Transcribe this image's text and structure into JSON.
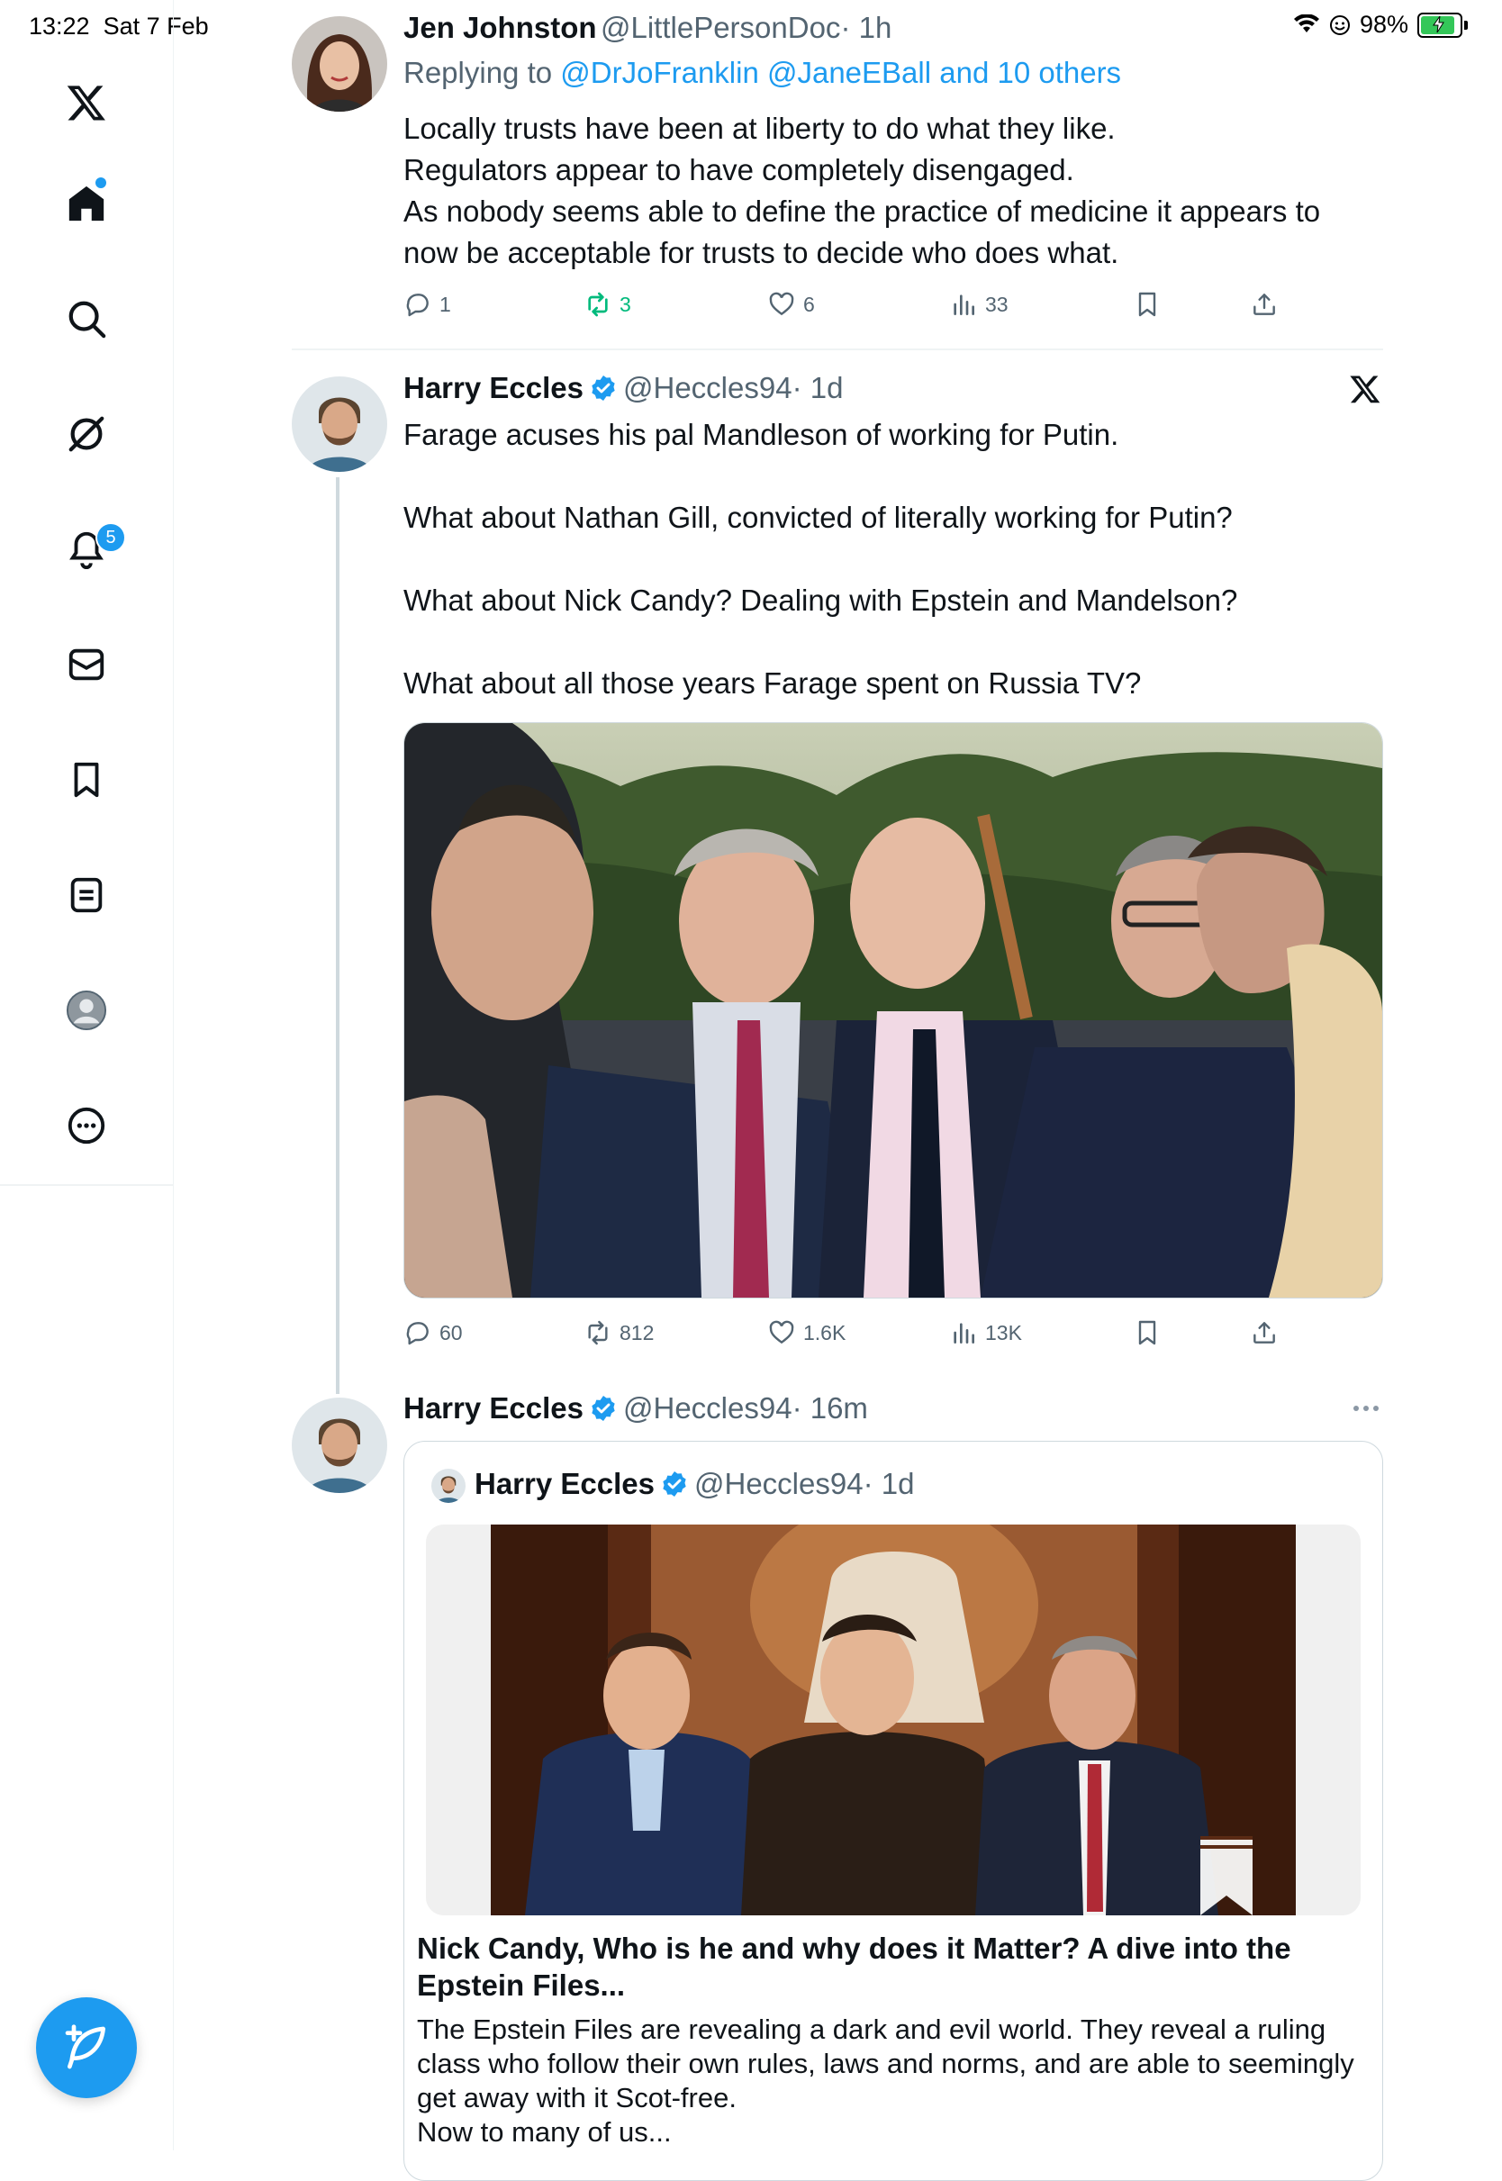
{
  "status_bar": {
    "time": "13:22",
    "date": "Sat 7 Feb",
    "battery": "98%",
    "battery_level": 0.98
  },
  "sidebar": {
    "items": [
      {
        "name": "x-logo-icon"
      },
      {
        "name": "home-icon"
      },
      {
        "name": "search-icon"
      },
      {
        "name": "grok-icon"
      },
      {
        "name": "notifications-icon",
        "badge": "5"
      },
      {
        "name": "messages-icon"
      },
      {
        "name": "bookmarks-icon"
      },
      {
        "name": "lists-icon"
      },
      {
        "name": "profile-avatar-icon"
      },
      {
        "name": "more-icon"
      }
    ]
  },
  "tweets": [
    {
      "name": "Jen Johnston",
      "handle": "@LittlePersonDoc",
      "time": "· 1h",
      "replying_prefix": "Replying to ",
      "replying_to": "@DrJoFranklin @JaneEBall and 10 others",
      "text": "Locally trusts have been at liberty to do what they like.\nRegulators appear to have completely disengaged.\nAs nobody seems able to define the practice of medicine it appears to\nnow be acceptable for trusts to decide who does what.",
      "replies": "1",
      "reposts": "3",
      "likes": "6",
      "views": "33"
    },
    {
      "name": "Harry Eccles",
      "handle": "@Heccles94",
      "time": "· 1d",
      "text": "Farage acuses his pal Mandleson of working for Putin.\n\nWhat about Nathan Gill, convicted of literally working for Putin?\n\nWhat about Nick Candy? Dealing with Epstein and Mandelson?\n\nWhat about all those years Farage spent on Russia TV?",
      "replies": "60",
      "reposts": "812",
      "likes": "1.6K",
      "views": "13K"
    },
    {
      "name": "Harry Eccles",
      "handle": "@Heccles94",
      "time": "· 16m",
      "quote": {
        "name": "Harry Eccles",
        "handle": "@Heccles94",
        "time": "· 1d",
        "card_title": "Nick Candy, Who is he and why does it Matter? A dive into the Epstein Files...",
        "card_desc": "The Epstein Files are revealing a dark and evil world. They reveal a ruling class who follow their own rules, laws and norms, and are able to seemingly get away with it Scot-free.\nNow to many of us..."
      }
    }
  ],
  "colors": {
    "accent": "#1d9bf0",
    "repost_active": "#00ba7c",
    "muted": "#536471",
    "text": "#0f1419"
  }
}
